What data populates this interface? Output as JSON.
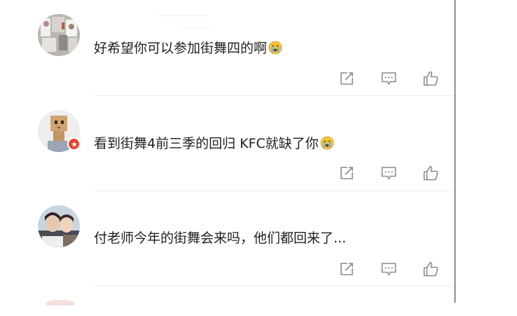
{
  "comments": [
    {
      "text": "好希望你可以参加街舞四的啊",
      "emoji": "crying-face-emoji",
      "has_badge": false
    },
    {
      "text": "看到街舞4前三季的回归 KFC就缺了你",
      "emoji": "crying-face-emoji",
      "has_badge": true
    },
    {
      "text": "付老师今年的街舞会来吗，他们都回来了...",
      "emoji": null,
      "has_badge": false
    }
  ],
  "action_icons": [
    "share-icon",
    "reply-icon",
    "like-icon"
  ],
  "colors": {
    "text": "#222222",
    "icon": "#8a8a8a",
    "badge": "#e8412c",
    "divider": "#ededed"
  }
}
